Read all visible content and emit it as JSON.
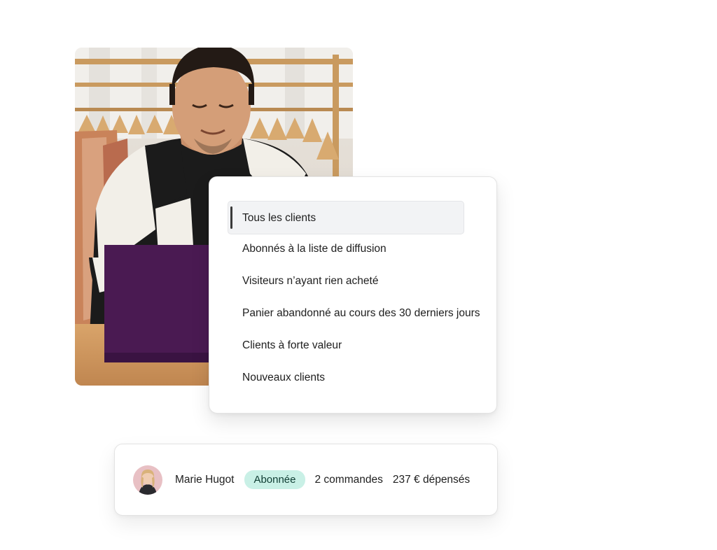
{
  "segments": {
    "items": [
      {
        "label": "Tous les clients",
        "selected": true
      },
      {
        "label": "Abonnés à la liste de diffusion",
        "selected": false
      },
      {
        "label": "Visiteurs n’ayant rien acheté",
        "selected": false
      },
      {
        "label": "Panier abandonné au cours des 30 derniers jours",
        "selected": false
      },
      {
        "label": "Clients à forte valeur",
        "selected": false
      },
      {
        "label": "Nouveaux clients",
        "selected": false
      }
    ]
  },
  "customer": {
    "name": "Marie Hugot",
    "status": "Abonnée",
    "orders": "2 commandes",
    "spent": "237 € dépensés"
  },
  "colors": {
    "badge_bg": "#c9f0e6",
    "selected_bg": "#f2f3f5",
    "laptop": "#4a1a52"
  }
}
